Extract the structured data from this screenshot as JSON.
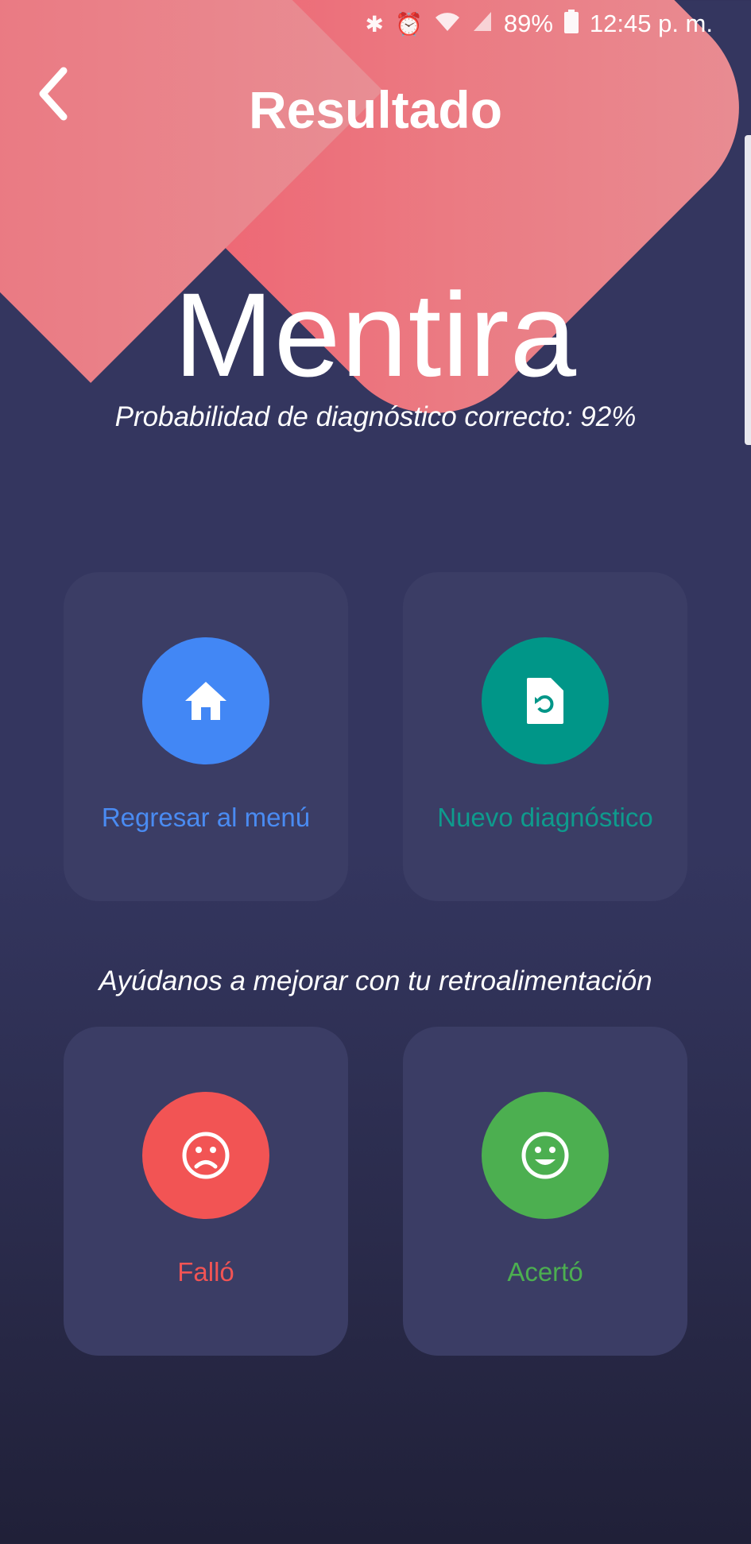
{
  "status_bar": {
    "icons": [
      "bluetooth-icon",
      "alarm-icon",
      "wifi-icon",
      "signal-icon",
      "battery-icon"
    ],
    "battery": "89%",
    "time": "12:45 p. m."
  },
  "header": {
    "title": "Resultado"
  },
  "result": {
    "verdict": "Mentira",
    "probability_text": "Probabilidad de diagnóstico correcto: 92%"
  },
  "actions": {
    "menu_label": "Regresar al menú",
    "new_label": "Nuevo diagnóstico"
  },
  "feedback": {
    "prompt": "Ayúdanos a mejorar con tu retroalimentación",
    "fail_label": "Falló",
    "success_label": "Acertó"
  },
  "colors": {
    "blob": "#ee6674",
    "card": "#3b3d65",
    "menu_blue": "#4287f5",
    "new_teal": "#009688",
    "fail_red": "#f25454",
    "success_green": "#4caf50"
  }
}
